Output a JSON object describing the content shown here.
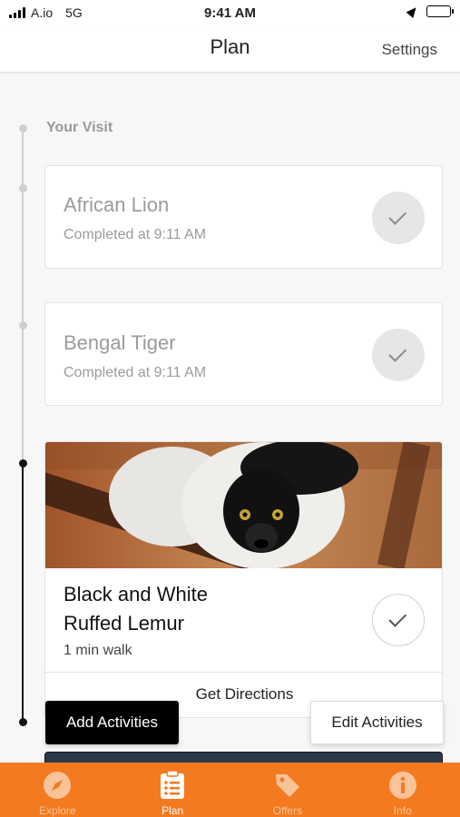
{
  "status_bar": {
    "carrier": "A.io",
    "network": "5G",
    "time": "9:41 AM"
  },
  "nav": {
    "title": "Plan",
    "settings_label": "Settings"
  },
  "section_label": "Your Visit",
  "activities": [
    {
      "title": "African Lion",
      "status": "Completed at 9:11 AM",
      "completed": true
    },
    {
      "title": "Bengal Tiger",
      "status": "Completed at 9:11 AM",
      "completed": true
    },
    {
      "title_line1": "Black and White",
      "title_line2": "Ruffed Lemur",
      "walk": "1 min walk",
      "directions_label": "Get Directions",
      "image": "lemur-photo",
      "completed": false
    }
  ],
  "buttons": {
    "add_activities": "Add Activities",
    "edit_activities": "Edit Activities"
  },
  "tabs": [
    {
      "label": "Explore",
      "icon": "compass-icon",
      "active": false
    },
    {
      "label": "Plan",
      "icon": "clipboard-list-icon",
      "active": true
    },
    {
      "label": "Offers",
      "icon": "tag-icon",
      "active": false
    },
    {
      "label": "Info",
      "icon": "info-icon",
      "active": false
    }
  ],
  "colors": {
    "accent": "#f47a1f",
    "timeline_done": "#cfcfcf",
    "timeline_current": "#111111"
  }
}
